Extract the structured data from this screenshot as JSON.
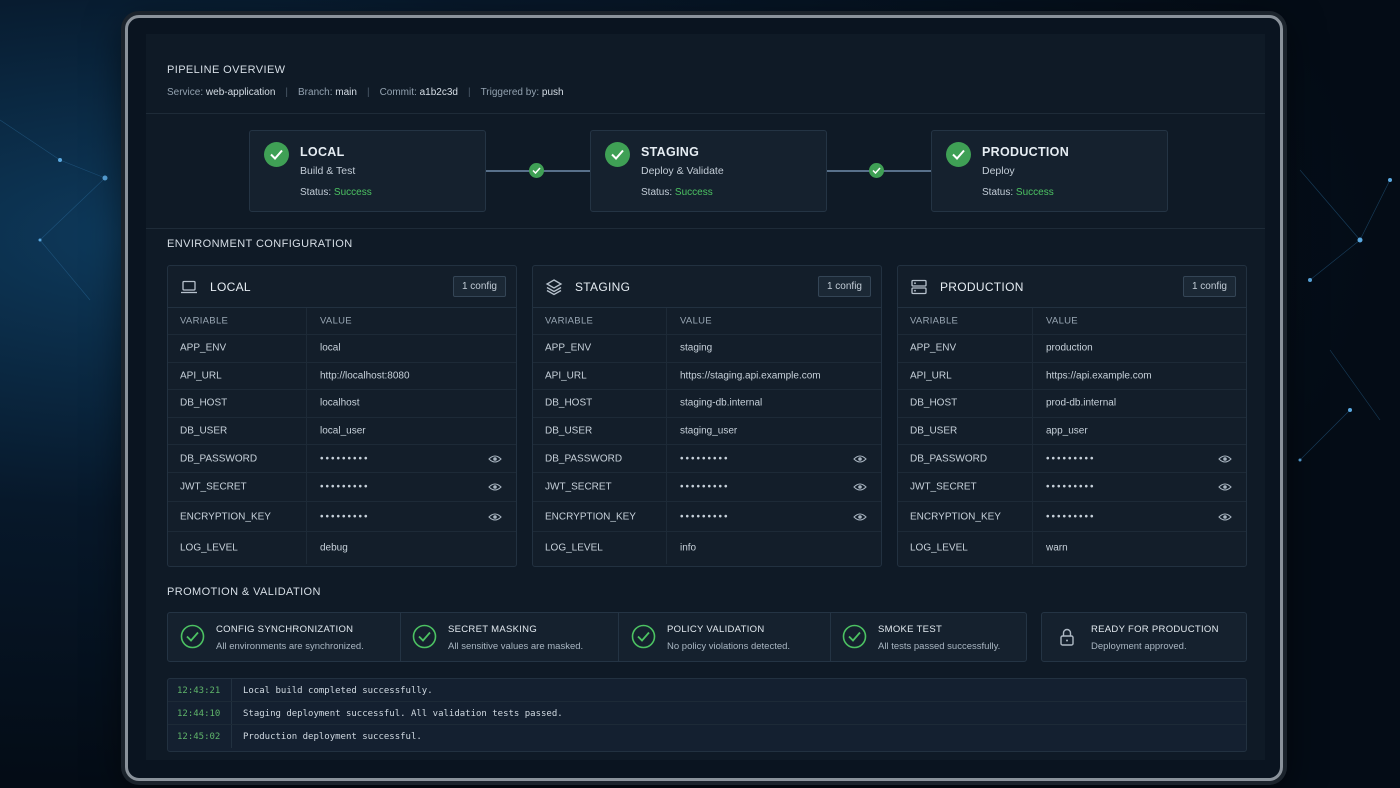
{
  "header": {
    "title": "PIPELINE OVERVIEW",
    "service_label": "Service:",
    "service": "web-application",
    "branch_label": "Branch:",
    "branch": "main",
    "commit_label": "Commit:",
    "commit": "a1b2c3d",
    "trigger_label": "Triggered by:",
    "trigger": "push",
    "separator": "|"
  },
  "pipeline": {
    "status_label": "Status:",
    "stages": [
      {
        "name": "LOCAL",
        "subtitle": "Build & Test",
        "status": "Success"
      },
      {
        "name": "STAGING",
        "subtitle": "Deploy & Validate",
        "status": "Success"
      },
      {
        "name": "PRODUCTION",
        "subtitle": "Deploy",
        "status": "Success"
      }
    ]
  },
  "env_config": {
    "title": "ENVIRONMENT CONFIGURATION",
    "col_variable": "VARIABLE",
    "col_value": "VALUE",
    "mask": "•••••••••",
    "environments": [
      {
        "name": "LOCAL",
        "icon": "laptop-icon",
        "badge": "1 config",
        "rows": [
          [
            "APP_ENV",
            "local"
          ],
          [
            "API_URL",
            "http://localhost:8080"
          ],
          [
            "DB_HOST",
            "localhost"
          ],
          [
            "DB_USER",
            "local_user"
          ],
          [
            "DB_PASSWORD",
            ""
          ],
          [
            "JWT_SECRET",
            ""
          ],
          [
            "ENCRYPTION_KEY",
            ""
          ],
          [
            "LOG_LEVEL",
            "debug"
          ]
        ]
      },
      {
        "name": "STAGING",
        "icon": "layers-icon",
        "badge": "1 config",
        "rows": [
          [
            "APP_ENV",
            "staging"
          ],
          [
            "API_URL",
            "https://staging.api.example.com"
          ],
          [
            "DB_HOST",
            "staging-db.internal"
          ],
          [
            "DB_USER",
            "staging_user"
          ],
          [
            "DB_PASSWORD",
            ""
          ],
          [
            "JWT_SECRET",
            ""
          ],
          [
            "ENCRYPTION_KEY",
            ""
          ],
          [
            "LOG_LEVEL",
            "info"
          ]
        ]
      },
      {
        "name": "PRODUCTION",
        "icon": "server-icon",
        "badge": "1 config",
        "rows": [
          [
            "APP_ENV",
            "production"
          ],
          [
            "API_URL",
            "https://api.example.com"
          ],
          [
            "DB_HOST",
            "prod-db.internal"
          ],
          [
            "DB_USER",
            "app_user"
          ],
          [
            "DB_PASSWORD",
            ""
          ],
          [
            "JWT_SECRET",
            ""
          ],
          [
            "ENCRYPTION_KEY",
            ""
          ],
          [
            "LOG_LEVEL",
            "warn"
          ]
        ]
      }
    ]
  },
  "promotion": {
    "title": "PROMOTION & VALIDATION",
    "checks": [
      {
        "title": "CONFIG SYNCHRONIZATION",
        "subtitle": "All environments are synchronized."
      },
      {
        "title": "SECRET MASKING",
        "subtitle": "All sensitive values are masked."
      },
      {
        "title": "POLICY VALIDATION",
        "subtitle": "No policy violations detected."
      },
      {
        "title": "SMOKE TEST",
        "subtitle": "All tests passed successfully."
      }
    ],
    "ready": {
      "title": "READY FOR PRODUCTION",
      "subtitle": "Deployment approved.",
      "icon": "lock-icon"
    }
  },
  "log": [
    {
      "time": "12:43:21",
      "message": "Local build completed successfully."
    },
    {
      "time": "12:44:10",
      "message": "Staging deployment successful. All validation tests passed."
    },
    {
      "time": "12:45:02",
      "message": "Production deployment successful."
    }
  ],
  "colors": {
    "success": "#4cc262",
    "check_bg": "#3fa055",
    "panel": "#131e2a"
  }
}
